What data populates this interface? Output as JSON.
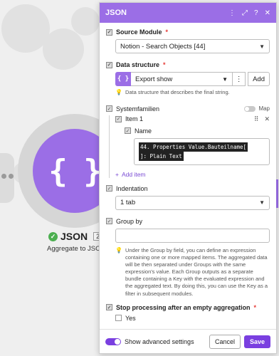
{
  "canvas": {
    "module_glyph": "{ }",
    "module_title": "JSON",
    "module_count": "2",
    "module_subtitle": "Aggregate to JSON"
  },
  "panel": {
    "title": "JSON",
    "source_module": {
      "label": "Source Module",
      "value": "Notion - Search Objects [44]"
    },
    "data_structure": {
      "label": "Data structure",
      "value": "Export show",
      "add_label": "Add",
      "hint": "Data structure that describes the final string."
    },
    "systemfamilien": {
      "label": "Systemfamilien",
      "map_label": "Map",
      "item_label": "Item 1",
      "name_label": "Name",
      "pill_1": "44. Properties Value.Bauteilname[",
      "pill_2": "]: Plain Text",
      "add_item": "Add item"
    },
    "indentation": {
      "label": "Indentation",
      "value": "1 tab"
    },
    "group_by": {
      "label": "Group by",
      "value": "",
      "hint": "Under the Group by field, you can define an expression containing one or more mapped items. The aggregated data will be then separated under Groups with the same expression's value. Each Group outputs as a separate bundle containing a Key with the evaluated expression and the aggregated text. By doing this, you can use the Key as a filter in subsequent modules."
    },
    "stop_processing": {
      "label": "Stop processing after an empty aggregation",
      "option": "Yes"
    },
    "footer": {
      "advanced_label": "Show advanced settings",
      "cancel_label": "Cancel",
      "save_label": "Save"
    }
  },
  "colors": {
    "accent": "#9b6ee6",
    "primary_button": "#7a3fe0",
    "success": "#4caf50"
  }
}
